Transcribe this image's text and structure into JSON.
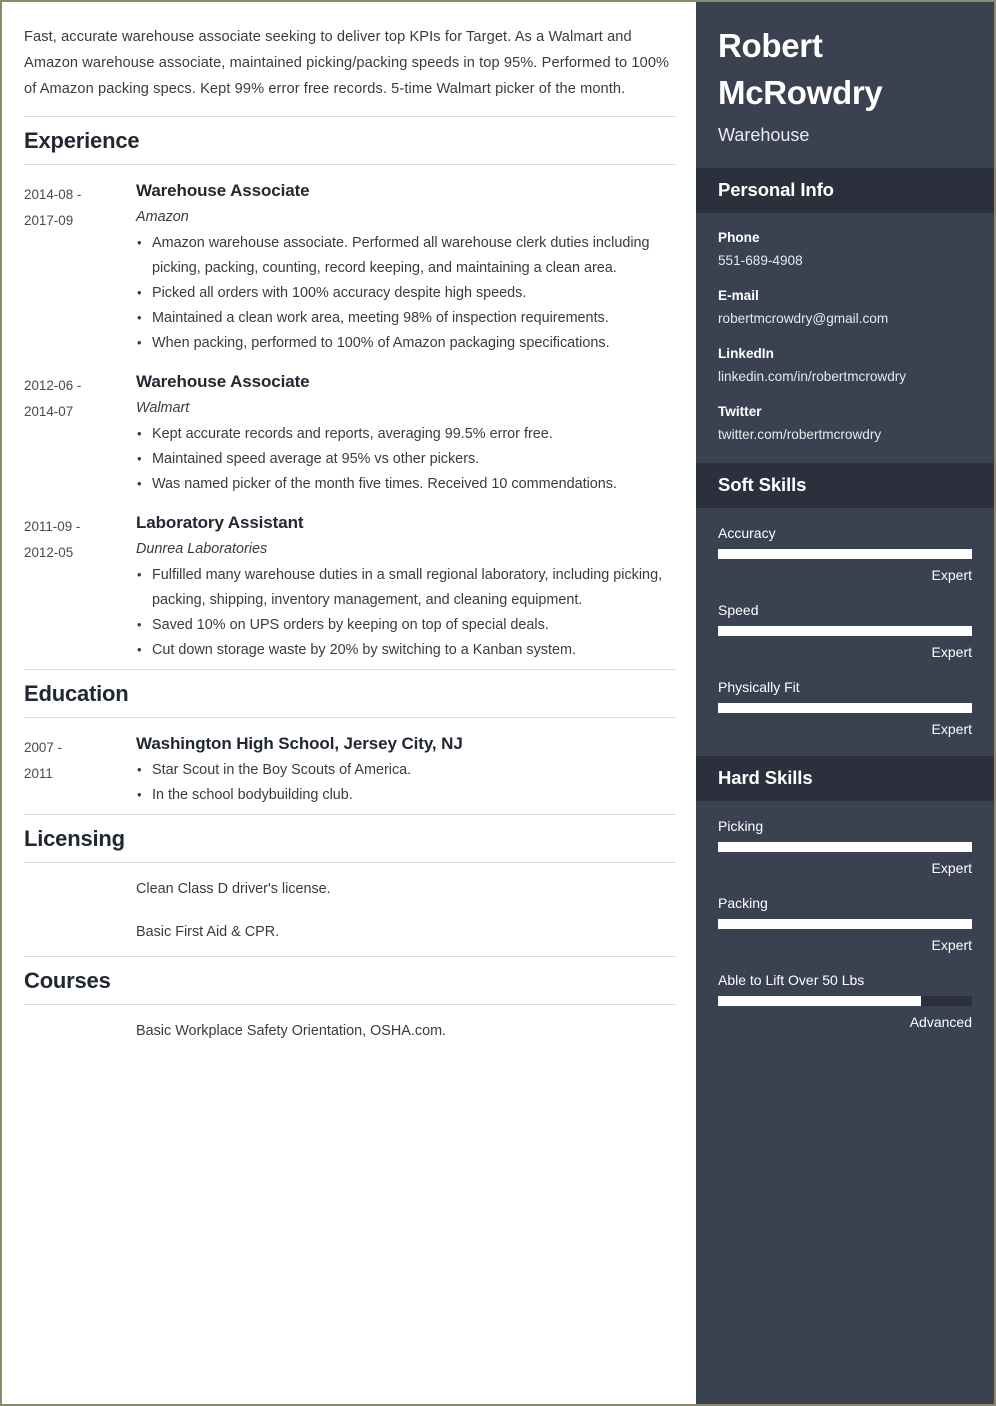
{
  "summary": "Fast, accurate warehouse associate seeking to deliver top KPIs for Target. As a Walmart and Amazon warehouse associate, maintained picking/packing speeds in top 95%. Performed to 100% of Amazon packing specs. Kept 99% error free records. 5-time Walmart picker of the month.",
  "sections": {
    "experience": {
      "heading": "Experience",
      "entries": [
        {
          "date_start": "2014-08 -",
          "date_end": "2017-09",
          "title": "Warehouse Associate",
          "org": "Amazon",
          "bullets": [
            "Amazon warehouse associate. Performed all warehouse clerk duties including picking, packing, counting, record keeping, and maintaining a clean area.",
            "Picked all orders with 100% accuracy despite high speeds.",
            "Maintained a clean work area, meeting 98% of inspection requirements.",
            "When packing, performed to 100% of Amazon packaging specifications."
          ]
        },
        {
          "date_start": "2012-06 -",
          "date_end": "2014-07",
          "title": "Warehouse Associate",
          "org": "Walmart",
          "bullets": [
            "Kept accurate records and reports, averaging 99.5% error free.",
            "Maintained speed average at 95% vs other pickers.",
            "Was named picker of the month five times. Received 10 commendations."
          ]
        },
        {
          "date_start": "2011-09 -",
          "date_end": "2012-05",
          "title": "Laboratory Assistant",
          "org": "Dunrea Laboratories",
          "bullets": [
            "Fulfilled many warehouse duties in a small regional laboratory, including picking, packing, shipping, inventory management, and cleaning equipment.",
            "Saved 10% on UPS orders by keeping on top of special deals.",
            "Cut down storage waste by 20% by switching to a Kanban system."
          ]
        }
      ]
    },
    "education": {
      "heading": "Education",
      "entries": [
        {
          "date_start": "2007 -",
          "date_end": "2011",
          "title": "Washington High School, Jersey City, NJ",
          "org": "",
          "bullets": [
            "Star Scout in the Boy Scouts of America.",
            "In the school bodybuilding club."
          ]
        }
      ]
    },
    "licensing": {
      "heading": "Licensing",
      "lines": [
        "Clean Class D driver's license.",
        "Basic First Aid & CPR."
      ]
    },
    "courses": {
      "heading": "Courses",
      "lines": [
        "Basic Workplace Safety Orientation, OSHA.com."
      ]
    }
  },
  "sidebar": {
    "name": "Robert McRowdry",
    "role": "Warehouse",
    "personal_info": {
      "heading": "Personal Info",
      "items": [
        {
          "label": "Phone",
          "value": "551-689-4908"
        },
        {
          "label": "E-mail",
          "value": "robertmcrowdry@gmail.com"
        },
        {
          "label": "LinkedIn",
          "value": "linkedin.com/in/robertmcrowdry"
        },
        {
          "label": "Twitter",
          "value": "twitter.com/robertmcrowdry"
        }
      ]
    },
    "soft_skills": {
      "heading": "Soft Skills",
      "items": [
        {
          "name": "Accuracy",
          "level": "Expert",
          "percent": 100
        },
        {
          "name": "Speed",
          "level": "Expert",
          "percent": 100
        },
        {
          "name": "Physically Fit",
          "level": "Expert",
          "percent": 100
        }
      ]
    },
    "hard_skills": {
      "heading": "Hard Skills",
      "items": [
        {
          "name": "Picking",
          "level": "Expert",
          "percent": 100
        },
        {
          "name": "Packing",
          "level": "Expert",
          "percent": 100
        },
        {
          "name": "Able to Lift Over 50 Lbs",
          "level": "Advanced",
          "percent": 80
        }
      ]
    }
  },
  "colors": {
    "sidebar_bg": "#3a4150",
    "sidebar_band": "#2b303c",
    "page_border": "#8a8a6e",
    "skill_fill": "#ffffff",
    "heading": "#222831"
  }
}
